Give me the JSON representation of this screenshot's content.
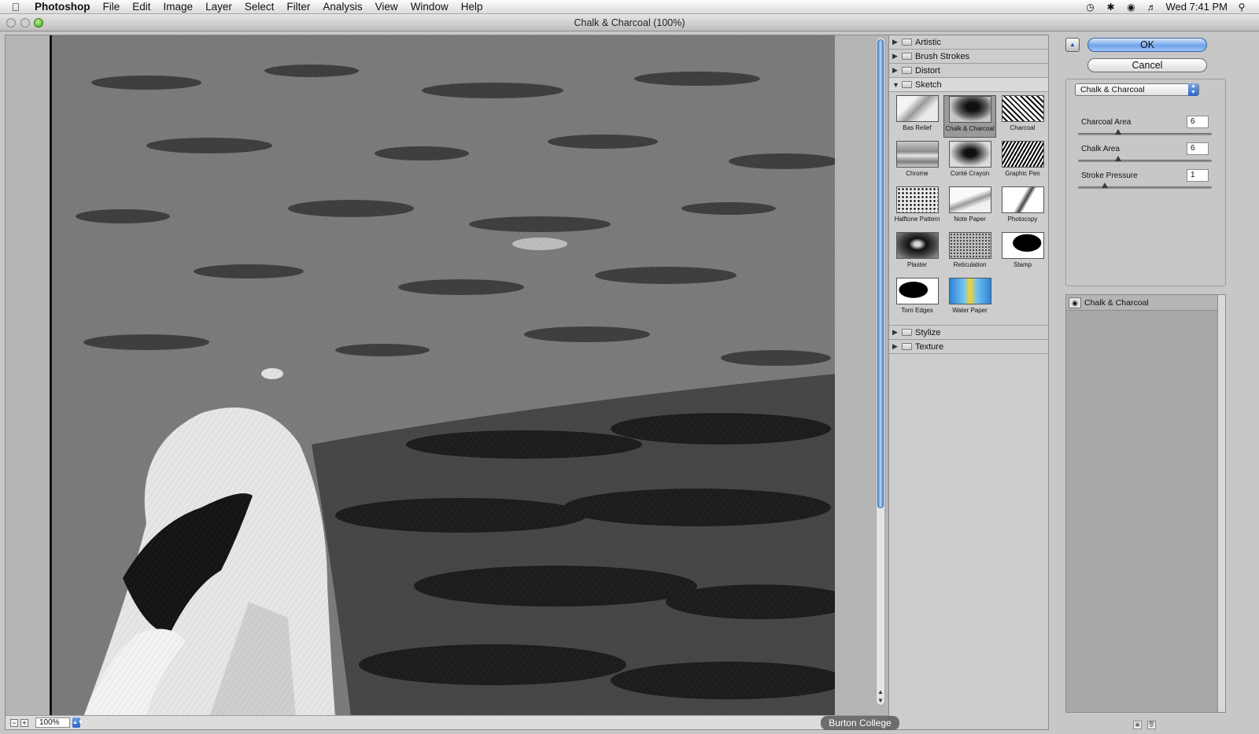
{
  "menubar": {
    "app_name": "Photoshop",
    "items": [
      "File",
      "Edit",
      "Image",
      "Layer",
      "Select",
      "Filter",
      "Analysis",
      "View",
      "Window",
      "Help"
    ],
    "clock": "Wed 7:41 PM",
    "status_icons": [
      "time-machine-icon",
      "bluetooth-icon",
      "wifi-icon",
      "volume-icon",
      "spotlight-icon"
    ]
  },
  "window": {
    "title": "Chalk & Charcoal (100%)"
  },
  "preview": {
    "zoom": "100%"
  },
  "filter_gallery": {
    "categories_top": [
      {
        "label": "Artistic",
        "open": false
      },
      {
        "label": "Brush Strokes",
        "open": false
      },
      {
        "label": "Distort",
        "open": false
      },
      {
        "label": "Sketch",
        "open": true
      }
    ],
    "sketch_filters": [
      "Bas Relief",
      "Chalk & Charcoal",
      "Charcoal",
      "Chrome",
      "Conté Crayon",
      "Graphic Pen",
      "Halftone Pattern",
      "Note Paper",
      "Photocopy",
      "Plaster",
      "Reticulation",
      "Stamp",
      "Torn Edges",
      "Water Paper"
    ],
    "selected_filter": "Chalk & Charcoal",
    "categories_bottom": [
      {
        "label": "Stylize",
        "open": false
      },
      {
        "label": "Texture",
        "open": false
      }
    ]
  },
  "panel": {
    "ok_label": "OK",
    "cancel_label": "Cancel",
    "filter_select": "Chalk & Charcoal",
    "params": [
      {
        "label": "Charcoal Area",
        "value": "6",
        "fraction": 0.3
      },
      {
        "label": "Chalk Area",
        "value": "6",
        "fraction": 0.3
      },
      {
        "label": "Stroke Pressure",
        "value": "1",
        "fraction": 0.2
      }
    ],
    "layer_name": "Chalk & Charcoal"
  },
  "watermark": "Burton College",
  "colors": {
    "accent": "#3d7dd8",
    "ok_button": "#6fa3ea"
  }
}
